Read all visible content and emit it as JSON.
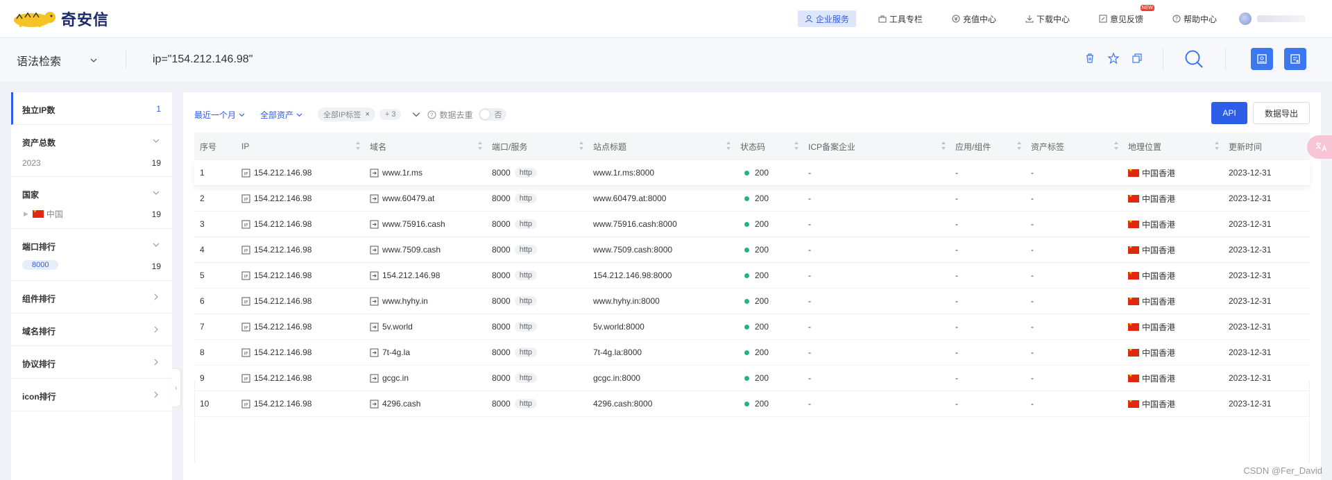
{
  "brand": {
    "name": "奇安信"
  },
  "topnav": {
    "items": [
      {
        "label": "企业服务",
        "icon": "enterprise-icon"
      },
      {
        "label": "工具专栏",
        "icon": "toolbox-icon"
      },
      {
        "label": "充值中心",
        "icon": "recharge-icon"
      },
      {
        "label": "下载中心",
        "icon": "download-icon"
      },
      {
        "label": "意见反馈",
        "icon": "feedback-icon",
        "badge": "NEW"
      },
      {
        "label": "帮助中心",
        "icon": "help-icon"
      }
    ]
  },
  "search": {
    "mode": "语法检索",
    "query": "ip=\"154.212.146.98\""
  },
  "sidebar": {
    "unique_ip": {
      "label": "独立IP数",
      "count": "1"
    },
    "total_assets": {
      "label": "资产总数",
      "sub": "2023",
      "count": "19"
    },
    "country": {
      "label": "国家",
      "sub": "中国",
      "count": "19"
    },
    "port_rank": {
      "label": "端口排行",
      "sub": "8000",
      "count": "19"
    },
    "component_rank": {
      "label": "组件排行"
    },
    "domain_rank": {
      "label": "域名排行"
    },
    "protocol_rank": {
      "label": "协议排行"
    },
    "icon_rank": {
      "label": "icon排行"
    }
  },
  "filters": {
    "time": "最近一个月",
    "assets": "全部资产",
    "tag": "全部IP标签",
    "more": "+ 3",
    "dedup_label": "数据去重",
    "dedup_value": "否"
  },
  "actions": {
    "api": "API",
    "export": "数据导出"
  },
  "table": {
    "headers": [
      "序号",
      "IP",
      "域名",
      "端口/服务",
      "站点标题",
      "状态码",
      "ICP备案企业",
      "应用/组件",
      "资产标签",
      "地理位置",
      "更新时间"
    ],
    "rows": [
      {
        "no": "1",
        "ip": "154.212.146.98",
        "domain": "www.1r.ms",
        "port": "8000",
        "service": "http",
        "title": "www.1r.ms:8000",
        "status": "200",
        "icp": "-",
        "app": "-",
        "tag": "-",
        "geo": "中国香港",
        "updated": "2023-12-31"
      },
      {
        "no": "2",
        "ip": "154.212.146.98",
        "domain": "www.60479.at",
        "port": "8000",
        "service": "http",
        "title": "www.60479.at:8000",
        "status": "200",
        "icp": "-",
        "app": "-",
        "tag": "-",
        "geo": "中国香港",
        "updated": "2023-12-31"
      },
      {
        "no": "3",
        "ip": "154.212.146.98",
        "domain": "www.75916.cash",
        "port": "8000",
        "service": "http",
        "title": "www.75916.cash:8000",
        "status": "200",
        "icp": "-",
        "app": "-",
        "tag": "-",
        "geo": "中国香港",
        "updated": "2023-12-31"
      },
      {
        "no": "4",
        "ip": "154.212.146.98",
        "domain": "www.7509.cash",
        "port": "8000",
        "service": "http",
        "title": "www.7509.cash:8000",
        "status": "200",
        "icp": "-",
        "app": "-",
        "tag": "-",
        "geo": "中国香港",
        "updated": "2023-12-31"
      },
      {
        "no": "5",
        "ip": "154.212.146.98",
        "domain": "154.212.146.98",
        "port": "8000",
        "service": "http",
        "title": "154.212.146.98:8000",
        "status": "200",
        "icp": "-",
        "app": "-",
        "tag": "-",
        "geo": "中国香港",
        "updated": "2023-12-31"
      },
      {
        "no": "6",
        "ip": "154.212.146.98",
        "domain": "www.hyhy.in",
        "port": "8000",
        "service": "http",
        "title": "www.hyhy.in:8000",
        "status": "200",
        "icp": "-",
        "app": "-",
        "tag": "-",
        "geo": "中国香港",
        "updated": "2023-12-31"
      },
      {
        "no": "7",
        "ip": "154.212.146.98",
        "domain": "5v.world",
        "port": "8000",
        "service": "http",
        "title": "5v.world:8000",
        "status": "200",
        "icp": "-",
        "app": "-",
        "tag": "-",
        "geo": "中国香港",
        "updated": "2023-12-31"
      },
      {
        "no": "8",
        "ip": "154.212.146.98",
        "domain": "7t-4g.la",
        "port": "8000",
        "service": "http",
        "title": "7t-4g.la:8000",
        "status": "200",
        "icp": "-",
        "app": "-",
        "tag": "-",
        "geo": "中国香港",
        "updated": "2023-12-31"
      },
      {
        "no": "9",
        "ip": "154.212.146.98",
        "domain": "gcgc.in",
        "port": "8000",
        "service": "http",
        "title": "gcgc.in:8000",
        "status": "200",
        "icp": "-",
        "app": "-",
        "tag": "-",
        "geo": "中国香港",
        "updated": "2023-12-31"
      },
      {
        "no": "10",
        "ip": "154.212.146.98",
        "domain": "4296.cash",
        "port": "8000",
        "service": "http",
        "title": "4296.cash:8000",
        "status": "200",
        "icp": "-",
        "app": "-",
        "tag": "-",
        "geo": "中国香港",
        "updated": "2023-12-31"
      }
    ]
  },
  "watermark": "CSDN @Fer_David",
  "colors": {
    "primary": "#2d5ce8",
    "status_ok": "#1fb67b",
    "brand_dark": "#1a2a6c"
  }
}
